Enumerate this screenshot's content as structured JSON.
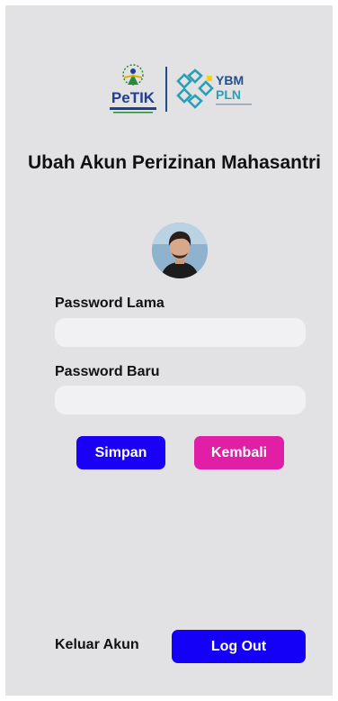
{
  "header": {
    "logo_left_text": "PeTIK",
    "logo_right_text_top": "YBM",
    "logo_right_text_bottom": "PLN"
  },
  "page": {
    "title": "Ubah Akun Perizinan Mahasantri"
  },
  "form": {
    "old_password_label": "Password Lama",
    "old_password_value": "",
    "new_password_label": "Password Baru",
    "new_password_value": ""
  },
  "actions": {
    "save_label": "Simpan",
    "back_label": "Kembali",
    "logout_prompt": "Keluar Akun",
    "logout_label": "Log Out"
  },
  "colors": {
    "background": "#e2e2e4",
    "save_button": "#1a00f5",
    "back_button": "#e01fa6",
    "logout_button": "#1400f7"
  },
  "icons": {
    "avatar": "user-avatar-photo"
  }
}
